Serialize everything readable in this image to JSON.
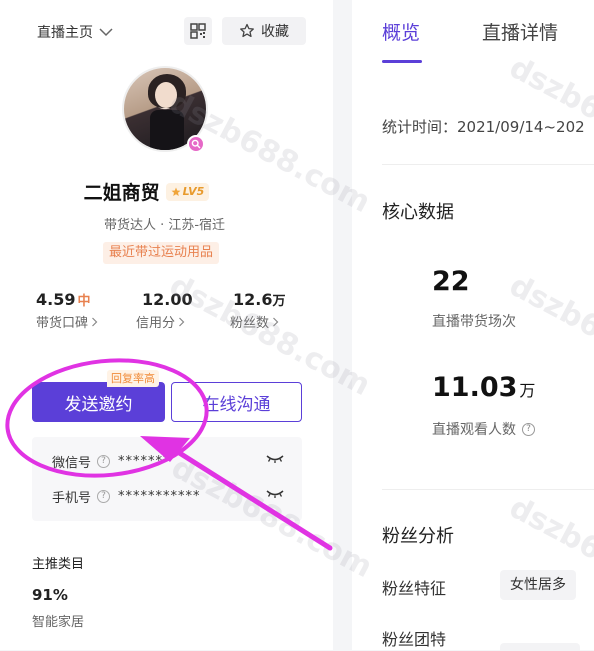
{
  "profile": {
    "home_link": "直播主页",
    "favorite_label": "收藏",
    "name": "二姐商贸",
    "level": "LV5",
    "subtitle": "带货达人 · 江苏-宿迁",
    "recent_tag": "最近带过运动用品",
    "stats": [
      {
        "value": "4.59",
        "suffix": "中",
        "label": "带货口碑"
      },
      {
        "value": "12.00",
        "suffix": "",
        "label": "信用分"
      },
      {
        "value": "12.6",
        "suffix": "万",
        "label": "粉丝数"
      }
    ],
    "reply_tag": "回复率高",
    "invite_label": "发送邀约",
    "chat_label": "在线沟通",
    "contacts": [
      {
        "label": "微信号",
        "value": "*******"
      },
      {
        "label": "手机号",
        "value": "***********"
      }
    ],
    "category": {
      "title": "主推类目",
      "percent": "91%",
      "name": "智能家居"
    }
  },
  "tabs": [
    {
      "label": "概览",
      "active": true
    },
    {
      "label": "直播详情",
      "active": false
    }
  ],
  "overview": {
    "stat_time": "统计时间：2021/09/14~202",
    "core_title": "核心数据",
    "live_sessions": {
      "value": "22",
      "label": "直播带货场次"
    },
    "viewers": {
      "value": "11.03",
      "unit": "万",
      "label": "直播观看人数"
    },
    "fans_title": "粉丝分析",
    "fan_feature_label": "粉丝特征",
    "fan_feature_tag": "女性居多",
    "fan_group_label": "粉丝团特"
  },
  "watermark": "dszb688.com",
  "colors": {
    "accent": "#5b3fd8",
    "orange": "#e8814f",
    "annotation": "#e033e3"
  }
}
